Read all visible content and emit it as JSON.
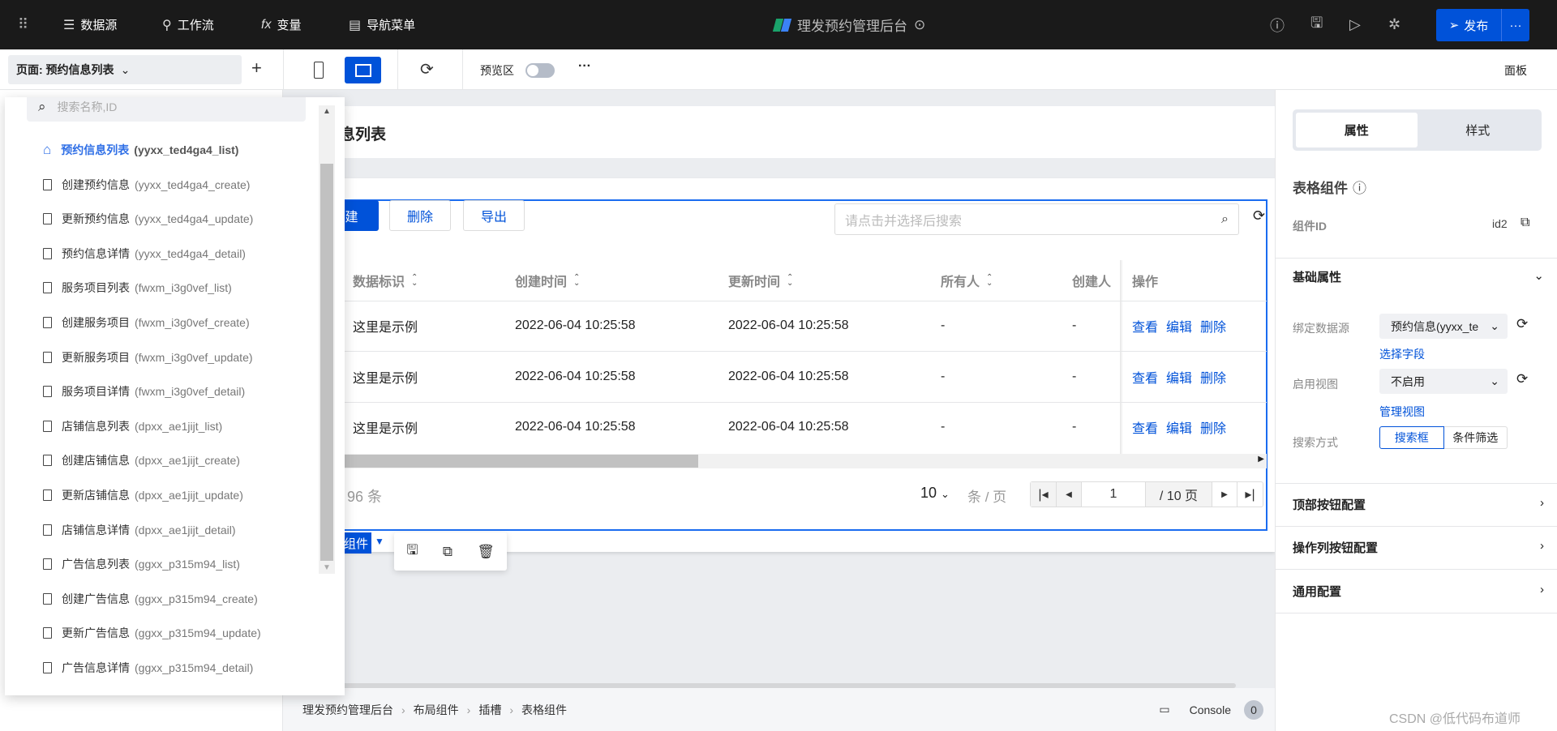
{
  "topbar": {
    "nav": [
      {
        "icon": "database-icon",
        "label": "数据源"
      },
      {
        "icon": "workflow-icon",
        "label": "工作流"
      },
      {
        "icon": "function-icon",
        "label": "变量"
      },
      {
        "icon": "menu-icon",
        "label": "导航菜单"
      }
    ],
    "app_title": "理发预约管理后台",
    "publish_label": "发布"
  },
  "toolbar": {
    "page_label": "页面: 预约信息列表",
    "preview_label": "预览区",
    "preview_on": false,
    "panel_label": "面板"
  },
  "dropdown": {
    "search_placeholder": "搜索名称,ID",
    "items": [
      {
        "name": "预约信息列表",
        "code": "(yyxx_ted4ga4_list)",
        "home": true
      },
      {
        "name": "创建预约信息",
        "code": "(yyxx_ted4ga4_create)"
      },
      {
        "name": "更新预约信息",
        "code": "(yyxx_ted4ga4_update)"
      },
      {
        "name": "预约信息详情",
        "code": "(yyxx_ted4ga4_detail)"
      },
      {
        "name": "服务项目列表",
        "code": "(fwxm_i3g0vef_list)"
      },
      {
        "name": "创建服务项目",
        "code": "(fwxm_i3g0vef_create)"
      },
      {
        "name": "更新服务项目",
        "code": "(fwxm_i3g0vef_update)"
      },
      {
        "name": "服务项目详情",
        "code": "(fwxm_i3g0vef_detail)"
      },
      {
        "name": "店铺信息列表",
        "code": "(dpxx_ae1jijt_list)"
      },
      {
        "name": "创建店铺信息",
        "code": "(dpxx_ae1jijt_create)"
      },
      {
        "name": "更新店铺信息",
        "code": "(dpxx_ae1jijt_update)"
      },
      {
        "name": "店铺信息详情",
        "code": "(dpxx_ae1jijt_detail)"
      },
      {
        "name": "广告信息列表",
        "code": "(ggxx_p315m94_list)"
      },
      {
        "name": "创建广告信息",
        "code": "(ggxx_p315m94_create)"
      },
      {
        "name": "更新广告信息",
        "code": "(ggxx_p315m94_update)"
      },
      {
        "name": "广告信息详情",
        "code": "(ggxx_p315m94_detail)"
      }
    ]
  },
  "canvas": {
    "page_title": "息列表",
    "buttons": {
      "create": "建",
      "delete": "删除",
      "export": "导出"
    },
    "search_placeholder": "请点击并选择后搜索",
    "columns": [
      "数据标识",
      "创建时间",
      "更新时间",
      "所有人",
      "创建人",
      "操作"
    ],
    "rows": [
      [
        "这里是示例",
        "2022-06-04 10:25:58",
        "2022-06-04 10:25:58",
        "-",
        "-"
      ],
      [
        "这里是示例",
        "2022-06-04 10:25:58",
        "2022-06-04 10:25:58",
        "-",
        "-"
      ],
      [
        "这里是示例",
        "2022-06-04 10:25:58",
        "2022-06-04 10:25:58",
        "-",
        "-"
      ]
    ],
    "row_actions": [
      "查看",
      "编辑",
      "删除"
    ],
    "total": "96 条",
    "page_size": "10",
    "page_size_unit": "条 / 页",
    "current_page": "1",
    "total_pages": "/ 10 页",
    "component_tag": "组件"
  },
  "breadcrumb": [
    "理发预约管理后台",
    "布局组件",
    "插槽",
    "表格组件"
  ],
  "console": {
    "label": "Console",
    "count": "0"
  },
  "panel": {
    "tabs": [
      "属性",
      "样式"
    ],
    "title": "表格组件",
    "id_label": "组件ID",
    "id_value": "id2",
    "basic": "基础属性",
    "datasource_label": "绑定数据源",
    "datasource_value": "预约信息(yyxx_te",
    "select_fields": "选择字段",
    "view_label": "启用视图",
    "view_value": "不启用",
    "manage_view": "管理视图",
    "search_label": "搜索方式",
    "search_options": [
      "搜索框",
      "条件筛选"
    ],
    "sections": [
      "顶部按钮配置",
      "操作列按钮配置",
      "通用配置"
    ]
  },
  "watermark": "CSDN @低代码布道师",
  "colors": {
    "accent": "#0052d9",
    "topbar": "#1a1a1a"
  }
}
